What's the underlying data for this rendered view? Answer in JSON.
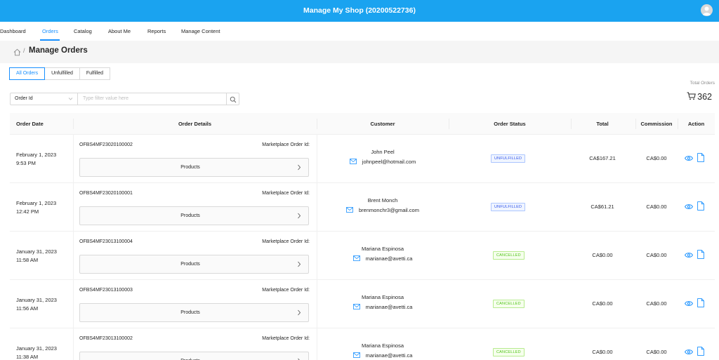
{
  "app": {
    "title": "Manage My Shop (20200522736)"
  },
  "nav": {
    "items": [
      "Dashboard",
      "Orders",
      "Catalog",
      "About Me",
      "Reports",
      "Manage Content"
    ],
    "active": "Orders"
  },
  "breadcrumb": {
    "separator": "/",
    "title": "Manage Orders"
  },
  "tabs": [
    "All Orders",
    "Unfulfilled",
    "Fulfilled"
  ],
  "totals": {
    "label": "Total Orders",
    "value": "362"
  },
  "filter": {
    "field": "Order Id",
    "placeholder": "Type filter value here"
  },
  "table": {
    "headers": [
      "Order Date",
      "Order Details",
      "Customer",
      "Order Status",
      "Total",
      "Commission",
      "Action"
    ],
    "marketplace_label": "Marketplace Order Id:",
    "products_label": "Products",
    "rows": [
      {
        "date": "February 1, 2023",
        "time": "9:53 PM",
        "order_id": "OFBS4MF23020100002",
        "customer": "John  Peel",
        "email": "johnpeel@hotmail.com",
        "status": "UNFULFILLED",
        "total": "CA$167.21",
        "commission": "CA$0.00"
      },
      {
        "date": "February 1, 2023",
        "time": "12:42 PM",
        "order_id": "OFBS4MF23020100001",
        "customer": "Brent  Monch",
        "email": "brenmonchr3@gmail.com",
        "status": "UNFULFILLED",
        "total": "CA$61.21",
        "commission": "CA$0.00"
      },
      {
        "date": "January 31, 2023",
        "time": "11:58 AM",
        "order_id": "OFBS4MF23013100004",
        "customer": "Mariana  Espinosa",
        "email": "marianae@avetti.ca",
        "status": "CANCELLED",
        "total": "CA$0.00",
        "commission": "CA$0.00"
      },
      {
        "date": "January 31, 2023",
        "time": "11:56 AM",
        "order_id": "OFBS4MF23013100003",
        "customer": "Mariana  Espinosa",
        "email": "marianae@avetti.ca",
        "status": "CANCELLED",
        "total": "CA$0.00",
        "commission": "CA$0.00"
      },
      {
        "date": "January 31, 2023",
        "time": "11:38 AM",
        "order_id": "OFBS4MF23013100002",
        "customer": "Mariana  Espinosa",
        "email": "marianae@avetti.ca",
        "status": "CANCELLED",
        "total": "CA$0.00",
        "commission": "CA$0.00"
      }
    ]
  },
  "colors": {
    "header": "#1aa3f0",
    "accent": "#1890ff",
    "unfulfilled": "#2f54eb",
    "cancelled": "#52c41a"
  },
  "icons": [
    "user-avatar-icon",
    "home-icon",
    "chevron-down-icon",
    "search-icon",
    "cart-icon",
    "chevron-right-icon",
    "mail-icon",
    "eye-icon",
    "file-icon"
  ]
}
